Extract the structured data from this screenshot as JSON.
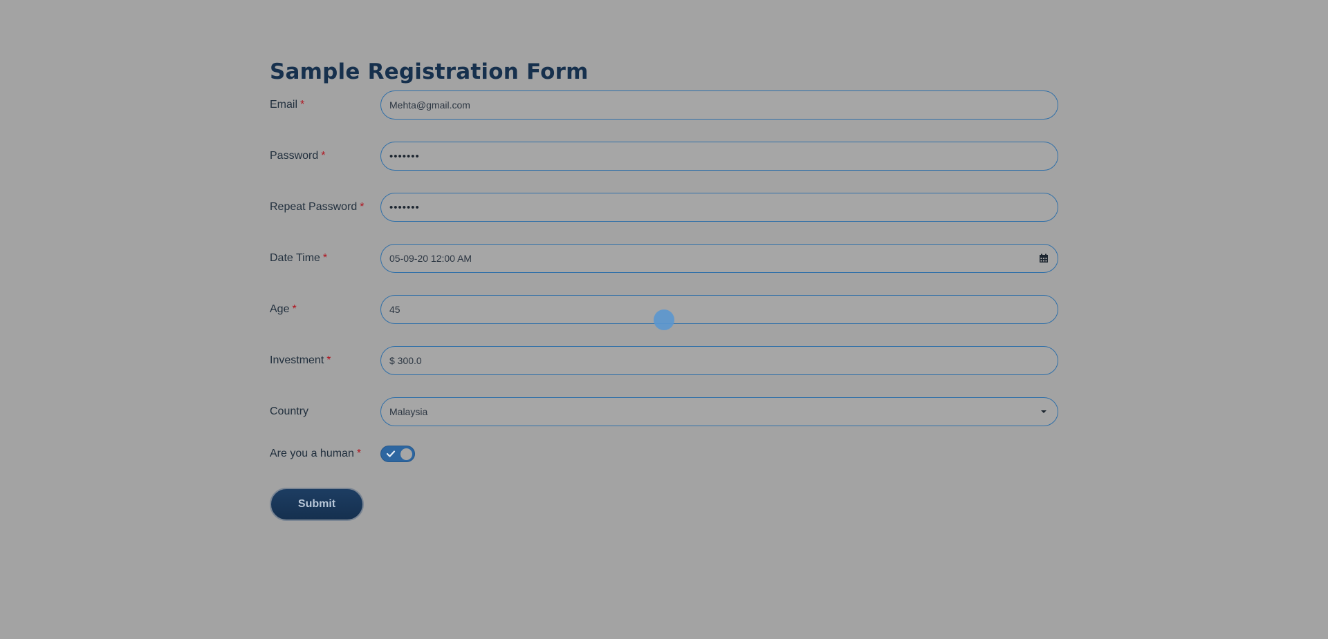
{
  "form": {
    "title": "Sample Registration Form",
    "fields": {
      "email": {
        "label": "Email",
        "required": "*",
        "value": "Mehta@gmail.com"
      },
      "password": {
        "label": "Password",
        "required": "*",
        "value": "•••••••"
      },
      "repeat_password": {
        "label": "Repeat Password",
        "required": "*",
        "value": "•••••••"
      },
      "datetime": {
        "label": "Date Time",
        "required": "*",
        "value": "05-09-20 12:00 AM",
        "icon": "calendar-icon"
      },
      "age": {
        "label": "Age",
        "required": "*",
        "value": "45"
      },
      "investment": {
        "label": "Investment",
        "required": "*",
        "value": "$ 300.0"
      },
      "country": {
        "label": "Country",
        "value": "Malaysia",
        "icon": "chevron-down-icon"
      },
      "human": {
        "label": "Are you a human",
        "required": "*",
        "checked": true,
        "icon": "check-icon"
      }
    },
    "submit_label": "Submit"
  },
  "colors": {
    "overlay_background": "#a3a3a3",
    "accent": "#2f6fa8",
    "title": "#16304d",
    "required": "#b0141f",
    "button": "#1d3d62"
  }
}
